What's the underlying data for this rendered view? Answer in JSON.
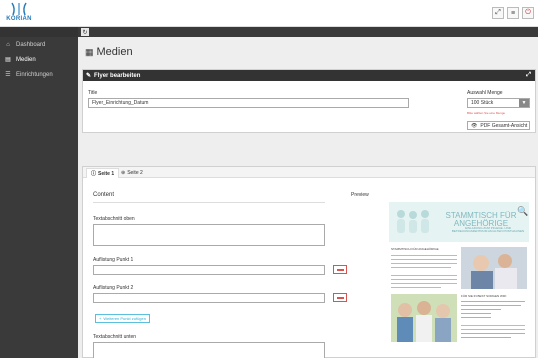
{
  "header": {
    "logo_text": "KORIAN",
    "icons": [
      "expand-icon",
      "menu-icon",
      "logout-icon"
    ]
  },
  "sidebar": {
    "items": [
      {
        "label": "Dashboard",
        "icon": "home-icon"
      },
      {
        "label": "Medien",
        "icon": "media-icon"
      },
      {
        "label": "Einrichtungen",
        "icon": "list-icon"
      }
    ]
  },
  "page": {
    "title": "Medien"
  },
  "flyer_panel": {
    "heading": "Flyer bearbeiten",
    "title_label": "Title",
    "title_value": "Flyer_Einrichtung_Datum",
    "quantity_label": "Auswahl Menge",
    "quantity_value": "100 Stück",
    "quantity_hint": "Bitte wählen Sie eine Menge",
    "pdf_button": "PDF Gesamt-Ansicht"
  },
  "tabs": {
    "items": [
      {
        "label": "Seite 1",
        "icon": "circle-info-icon"
      },
      {
        "label": "Seite 2",
        "icon": "circle-plus-icon"
      }
    ]
  },
  "content": {
    "heading": "Content",
    "preview_label": "Preview",
    "text_top_label": "Textabschnitt oben",
    "bullet1_label": "Auflistung Punkt 1",
    "bullet2_label": "Auflistung Punkt 2",
    "add_bullet_button": "Weiteren Punkt zufügen",
    "text_bottom_label": "Textabschnitt unten"
  },
  "preview": {
    "banner_title": "STAMMTISCH FÜR ANGEHÖRIGE",
    "banner_sub": "EINLADUNG ZUM PFLEGE- UND BETREUUNGSZENTRUM AM ALTEN POSTHAUSEN",
    "section1": "STAMMTISCH FÜR ANGEHÖRIGE",
    "section2": "FÜR SIE IN BEST SORGEN WIR:",
    "accent_color": "#7fb9bf"
  },
  "colors": {
    "sidebar_bg": "#3a3a3a",
    "panel_header_bg": "#333333",
    "danger": "#d9534f",
    "info": "#5bc0de",
    "brand_blue": "#2a79b8"
  }
}
